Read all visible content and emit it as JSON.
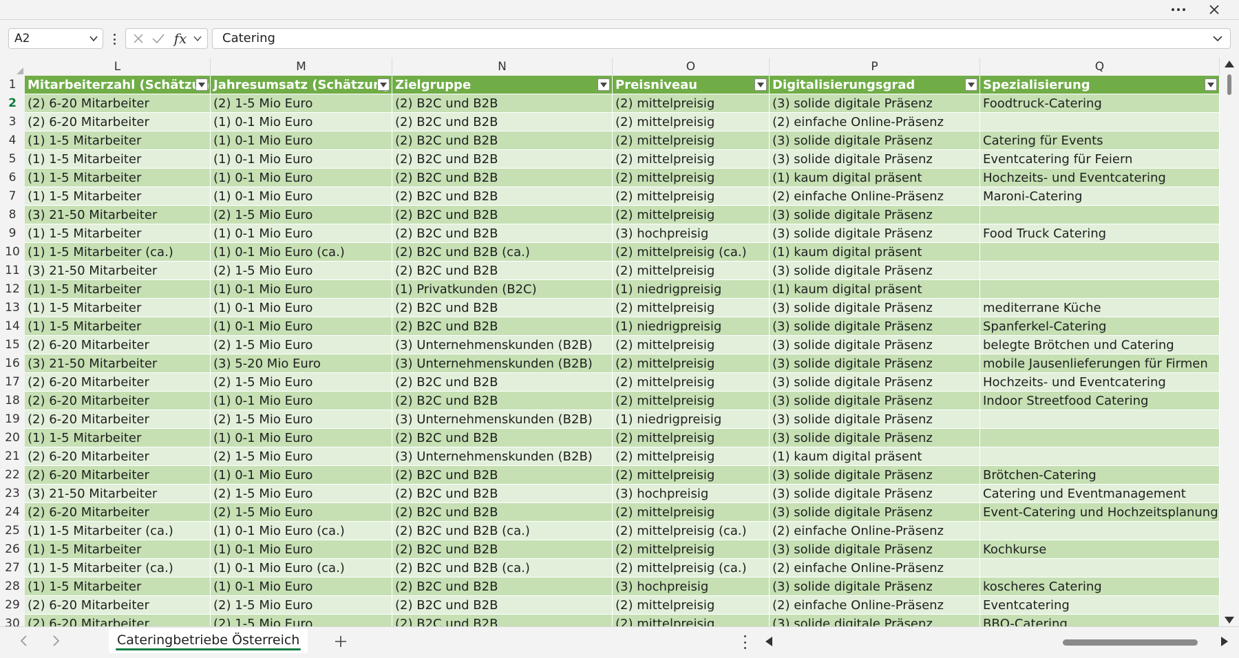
{
  "window": {
    "more_icon": "ellipsis-icon",
    "close_icon": "close-icon"
  },
  "formula_bar": {
    "name_box": "A2",
    "fx_label": "fx",
    "value": "Catering"
  },
  "columns": [
    "L",
    "M",
    "N",
    "O",
    "P",
    "Q"
  ],
  "header_row": {
    "num": "1",
    "cells": [
      "Mitarbeiterzahl (Schätzung)",
      "Jahresumsatz (Schätzung)",
      "Zielgruppe",
      "Preisniveau",
      "Digitalisierungsgrad",
      "Spezialisierung"
    ]
  },
  "rows": [
    {
      "num": "2",
      "cells": [
        "(2) 6-20 Mitarbeiter",
        "(2) 1-5 Mio Euro",
        "(2) B2C und B2B",
        "(2) mittelpreisig",
        "(3) solide digitale Präsenz",
        "Foodtruck-Catering"
      ]
    },
    {
      "num": "3",
      "cells": [
        "(2) 6-20 Mitarbeiter",
        "(1) 0-1 Mio Euro",
        "(2) B2C und B2B",
        "(2) mittelpreisig",
        "(2) einfache Online-Präsenz",
        ""
      ]
    },
    {
      "num": "4",
      "cells": [
        "(1) 1-5 Mitarbeiter",
        "(1) 0-1 Mio Euro",
        "(2) B2C und B2B",
        "(2) mittelpreisig",
        "(3) solide digitale Präsenz",
        "Catering für Events"
      ]
    },
    {
      "num": "5",
      "cells": [
        "(1) 1-5 Mitarbeiter",
        "(1) 0-1 Mio Euro",
        "(2) B2C und B2B",
        "(2) mittelpreisig",
        "(3) solide digitale Präsenz",
        "Eventcatering für Feiern"
      ]
    },
    {
      "num": "6",
      "cells": [
        "(1) 1-5 Mitarbeiter",
        "(1) 0-1 Mio Euro",
        "(2) B2C und B2B",
        "(2) mittelpreisig",
        "(1) kaum digital präsent",
        "Hochzeits- und Eventcatering"
      ]
    },
    {
      "num": "7",
      "cells": [
        "(1) 1-5 Mitarbeiter",
        "(1) 0-1 Mio Euro",
        "(2) B2C und B2B",
        "(2) mittelpreisig",
        "(2) einfache Online-Präsenz",
        "Maroni-Catering"
      ]
    },
    {
      "num": "8",
      "cells": [
        "(3) 21-50 Mitarbeiter",
        "(2) 1-5 Mio Euro",
        "(2) B2C und B2B",
        "(2) mittelpreisig",
        "(3) solide digitale Präsenz",
        ""
      ]
    },
    {
      "num": "9",
      "cells": [
        "(1) 1-5 Mitarbeiter",
        "(1) 0-1 Mio Euro",
        "(2) B2C und B2B",
        "(3) hochpreisig",
        "(3) solide digitale Präsenz",
        "Food Truck Catering"
      ]
    },
    {
      "num": "10",
      "cells": [
        "(1) 1-5 Mitarbeiter (ca.)",
        "(1) 0-1 Mio Euro (ca.)",
        "(2) B2C und B2B (ca.)",
        "(2) mittelpreisig (ca.)",
        "(1) kaum digital präsent",
        ""
      ]
    },
    {
      "num": "11",
      "cells": [
        "(3) 21-50 Mitarbeiter",
        "(2) 1-5 Mio Euro",
        "(2) B2C und B2B",
        "(2) mittelpreisig",
        "(3) solide digitale Präsenz",
        ""
      ]
    },
    {
      "num": "12",
      "cells": [
        "(1) 1-5 Mitarbeiter",
        "(1) 0-1 Mio Euro",
        "(1) Privatkunden (B2C)",
        "(1) niedrigpreisig",
        "(1) kaum digital präsent",
        ""
      ]
    },
    {
      "num": "13",
      "cells": [
        "(1) 1-5 Mitarbeiter",
        "(1) 0-1 Mio Euro",
        "(2) B2C und B2B",
        "(2) mittelpreisig",
        "(3) solide digitale Präsenz",
        "mediterrane Küche"
      ]
    },
    {
      "num": "14",
      "cells": [
        "(1) 1-5 Mitarbeiter",
        "(1) 0-1 Mio Euro",
        "(2) B2C und B2B",
        "(1) niedrigpreisig",
        "(3) solide digitale Präsenz",
        "Spanferkel-Catering"
      ]
    },
    {
      "num": "15",
      "cells": [
        "(2) 6-20 Mitarbeiter",
        "(2) 1-5 Mio Euro",
        "(3) Unternehmenskunden (B2B)",
        "(2) mittelpreisig",
        "(3) solide digitale Präsenz",
        "belegte Brötchen und Catering"
      ]
    },
    {
      "num": "16",
      "cells": [
        "(3) 21-50 Mitarbeiter",
        "(3) 5-20 Mio Euro",
        "(3) Unternehmenskunden (B2B)",
        "(2) mittelpreisig",
        "(3) solide digitale Präsenz",
        "mobile Jausenlieferungen für Firmen"
      ]
    },
    {
      "num": "17",
      "cells": [
        "(2) 6-20 Mitarbeiter",
        "(2) 1-5 Mio Euro",
        "(2) B2C und B2B",
        "(2) mittelpreisig",
        "(3) solide digitale Präsenz",
        "Hochzeits- und Eventcatering"
      ]
    },
    {
      "num": "18",
      "cells": [
        "(2) 6-20 Mitarbeiter",
        "(1) 0-1 Mio Euro",
        "(2) B2C und B2B",
        "(2) mittelpreisig",
        "(3) solide digitale Präsenz",
        "Indoor Streetfood Catering"
      ]
    },
    {
      "num": "19",
      "cells": [
        "(2) 6-20 Mitarbeiter",
        "(2) 1-5 Mio Euro",
        "(3) Unternehmenskunden (B2B)",
        "(1) niedrigpreisig",
        "(3) solide digitale Präsenz",
        ""
      ]
    },
    {
      "num": "20",
      "cells": [
        "(1) 1-5 Mitarbeiter",
        "(1) 0-1 Mio Euro",
        "(2) B2C und B2B",
        "(2) mittelpreisig",
        "(3) solide digitale Präsenz",
        ""
      ]
    },
    {
      "num": "21",
      "cells": [
        "(2) 6-20 Mitarbeiter",
        "(2) 1-5 Mio Euro",
        "(3) Unternehmenskunden (B2B)",
        "(2) mittelpreisig",
        "(1) kaum digital präsent",
        ""
      ]
    },
    {
      "num": "22",
      "cells": [
        "(2) 6-20 Mitarbeiter",
        "(1) 0-1 Mio Euro",
        "(2) B2C und B2B",
        "(2) mittelpreisig",
        "(3) solide digitale Präsenz",
        "Brötchen-Catering"
      ]
    },
    {
      "num": "23",
      "cells": [
        "(3) 21-50 Mitarbeiter",
        "(2) 1-5 Mio Euro",
        "(2) B2C und B2B",
        "(3) hochpreisig",
        "(3) solide digitale Präsenz",
        "Catering und Eventmanagement"
      ]
    },
    {
      "num": "24",
      "cells": [
        "(2) 6-20 Mitarbeiter",
        "(2) 1-5 Mio Euro",
        "(2) B2C und B2B",
        "(2) mittelpreisig",
        "(3) solide digitale Präsenz",
        "Event-Catering und Hochzeitsplanung"
      ]
    },
    {
      "num": "25",
      "cells": [
        "(1) 1-5 Mitarbeiter (ca.)",
        "(1) 0-1 Mio Euro (ca.)",
        "(2) B2C und B2B (ca.)",
        "(2) mittelpreisig (ca.)",
        "(2) einfache Online-Präsenz",
        ""
      ]
    },
    {
      "num": "26",
      "cells": [
        "(1) 1-5 Mitarbeiter",
        "(1) 0-1 Mio Euro",
        "(2) B2C und B2B",
        "(2) mittelpreisig",
        "(3) solide digitale Präsenz",
        "Kochkurse"
      ]
    },
    {
      "num": "27",
      "cells": [
        "(1) 1-5 Mitarbeiter (ca.)",
        "(1) 0-1 Mio Euro (ca.)",
        "(2) B2C und B2B (ca.)",
        "(2) mittelpreisig (ca.)",
        "(2) einfache Online-Präsenz",
        ""
      ]
    },
    {
      "num": "28",
      "cells": [
        "(1) 1-5 Mitarbeiter",
        "(1) 0-1 Mio Euro",
        "(2) B2C und B2B",
        "(3) hochpreisig",
        "(3) solide digitale Präsenz",
        "koscheres Catering"
      ]
    },
    {
      "num": "29",
      "cells": [
        "(2) 6-20 Mitarbeiter",
        "(2) 1-5 Mio Euro",
        "(2) B2C und B2B",
        "(2) mittelpreisig",
        "(2) einfache Online-Präsenz",
        "Eventcatering"
      ]
    },
    {
      "num": "30",
      "cells": [
        "(2) 6-20 Mitarbeiter",
        "(2) 1-5 Mio Euro",
        "(2) B2C und B2B",
        "(2) mittelpreisig",
        "(3) solide digitale Präsenz",
        "BBQ-Catering"
      ]
    }
  ],
  "selected_row": "2",
  "sheet_tab": {
    "label": "Cateringbetriebe Österreich"
  },
  "colors": {
    "header_green": "#70ad47",
    "band_dark": "#c6e0b4",
    "band_light": "#e2efda",
    "accent": "#107c41"
  }
}
